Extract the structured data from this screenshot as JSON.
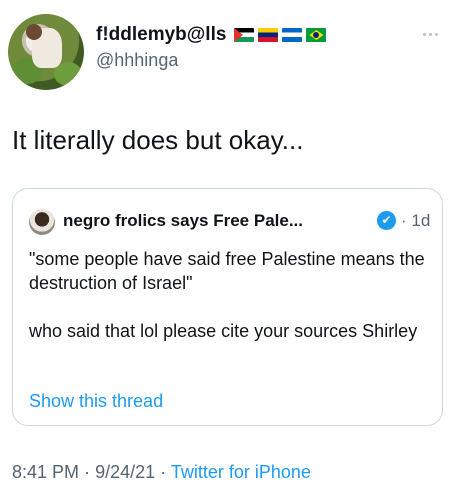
{
  "tweet": {
    "display_name": "f!ddlemyb@lls",
    "flags": [
      "palestine-flag",
      "venezuela-flag",
      "nicaragua-flag",
      "brazil-flag"
    ],
    "handle": "@hhhinga",
    "text": "It literally does but okay...",
    "time": "8:41 PM",
    "date": "9/24/21",
    "separator": "·",
    "source": "Twitter for iPhone"
  },
  "quote": {
    "display_name": "negro frolics says Free Pale...",
    "verified_icon": "✔",
    "time_sep": "·",
    "time": "1d",
    "paragraphs": [
      "\"some people have said free Palestine means the destruction of Israel\"",
      "who said that lol please cite your sources Shirley"
    ],
    "show_thread": "Show this thread"
  },
  "colors": {
    "link_blue": "#1d9bf0",
    "secondary_text": "#536471",
    "border": "#cfd9de"
  }
}
